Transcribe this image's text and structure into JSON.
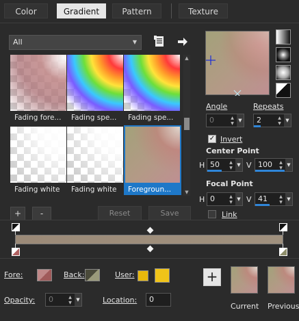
{
  "tabs": [
    {
      "label": "Color",
      "active": false
    },
    {
      "label": "Gradient",
      "active": true
    },
    {
      "label": "Pattern",
      "active": false
    },
    {
      "label": "Texture",
      "active": false
    }
  ],
  "library": {
    "filter_selected": "All",
    "thumbnails": [
      {
        "label": "Fading fore...",
        "selected": false
      },
      {
        "label": "Fading spe...",
        "selected": false
      },
      {
        "label": "Fading spe...",
        "selected": false
      },
      {
        "label": "Fading white",
        "selected": false
      },
      {
        "label": "Fading white",
        "selected": false
      },
      {
        "label": "Foregroun...",
        "selected": true
      }
    ],
    "add_label": "+",
    "remove_label": "-",
    "reset_label": "Reset",
    "save_label": "Save"
  },
  "settings": {
    "angle_label": "Angle",
    "angle_value": "0",
    "repeats_label": "Repeats",
    "repeats_value": "2",
    "invert_label": "Invert",
    "invert_checked": true,
    "center_point_label": "Center Point",
    "center_h_label": "H",
    "center_h_value": "50",
    "center_v_label": "V",
    "center_v_value": "100",
    "focal_point_label": "Focal Point",
    "focal_h_label": "H",
    "focal_h_value": "0",
    "focal_v_label": "V",
    "focal_v_value": "41",
    "link_label": "Link",
    "link_checked": false
  },
  "gradient_editor": {
    "start_color": "#9b8a78",
    "end_color": "#a0917e"
  },
  "bottom": {
    "fore_label": "Fore:",
    "back_label": "Back:",
    "user_label": "User:",
    "user_color_1": "#e8b80c",
    "user_color_2": "#f0c419",
    "opacity_label": "Opacity:",
    "opacity_value": "0",
    "location_label": "Location:",
    "location_value": "0",
    "add_label": "+",
    "current_label": "Current",
    "previous_label": "Previous"
  }
}
